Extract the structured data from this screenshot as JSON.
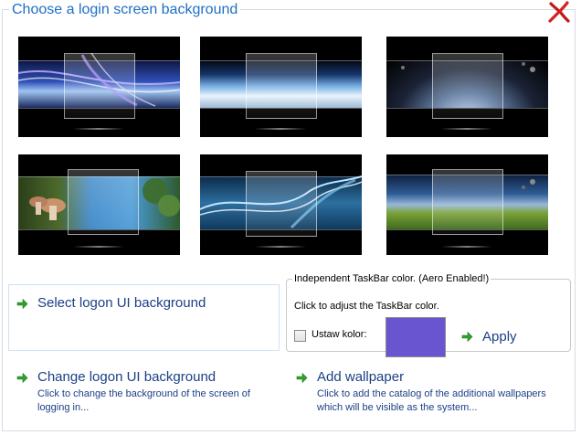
{
  "title": "Choose a login screen background",
  "close_icon": "close-icon",
  "accent_color": "#1f6fc5",
  "link_color": "#1b3f86",
  "thumbnails": [
    {
      "name": "thumb-aurora-rays",
      "theme": "purple light streaks"
    },
    {
      "name": "thumb-clouds",
      "theme": "blue clouds horizon"
    },
    {
      "name": "thumb-planet-space",
      "theme": "planet in space"
    },
    {
      "name": "thumb-mushrooms",
      "theme": "mushrooms and leaves"
    },
    {
      "name": "thumb-blue-waves",
      "theme": "blue light waves"
    },
    {
      "name": "thumb-grass-field",
      "theme": "green grass field and sky"
    }
  ],
  "select_logon": {
    "label": "Select logon UI background"
  },
  "taskbar": {
    "legend": "Independent TaskBar color. (Aero Enabled!)",
    "description": "Click to adjust the TaskBar color.",
    "checkbox_label": "Ustaw kolor:",
    "checkbox_checked": false,
    "color": "#6a55d0",
    "apply_label": "Apply"
  },
  "change_logon": {
    "label": "Change logon UI background",
    "description": "Click to change the background of the screen of logging in..."
  },
  "add_wallpaper": {
    "label": "Add wallpaper",
    "description": "Click to add the catalog of the additional wallpapers which will be visible as the system..."
  }
}
